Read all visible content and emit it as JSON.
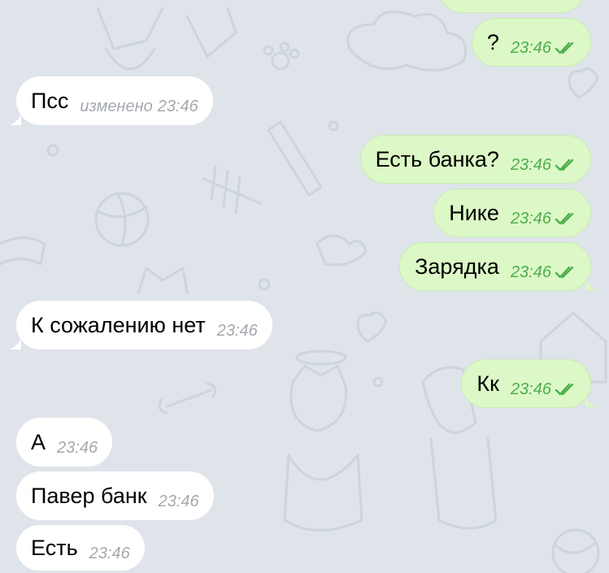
{
  "messages": [
    {
      "text": "?",
      "time": "23:46",
      "dir": "out"
    },
    {
      "text": "Псс",
      "edited": "изменено",
      "time": "23:46",
      "dir": "in"
    },
    {
      "text": "Есть банка?",
      "time": "23:46",
      "dir": "out"
    },
    {
      "text": "Нике",
      "time": "23:46",
      "dir": "out"
    },
    {
      "text": "Зарядка",
      "time": "23:46",
      "dir": "out"
    },
    {
      "text": "К сожалению нет",
      "time": "23:46",
      "dir": "in"
    },
    {
      "text": "Кк",
      "time": "23:46",
      "dir": "out"
    },
    {
      "text": "А",
      "time": "23:46",
      "dir": "in"
    },
    {
      "text": "Павер банк",
      "time": "23:46",
      "dir": "in"
    },
    {
      "text": "Есть",
      "time": "23:46",
      "dir": "in"
    }
  ],
  "colors": {
    "background": "#dfe4ea",
    "incoming_bubble": "#ffffff",
    "outgoing_bubble": "#dcf8c6",
    "outgoing_meta": "#4fae4e",
    "incoming_meta": "#a4a9ae"
  },
  "icons": {
    "read_status": "double-check-icon"
  }
}
